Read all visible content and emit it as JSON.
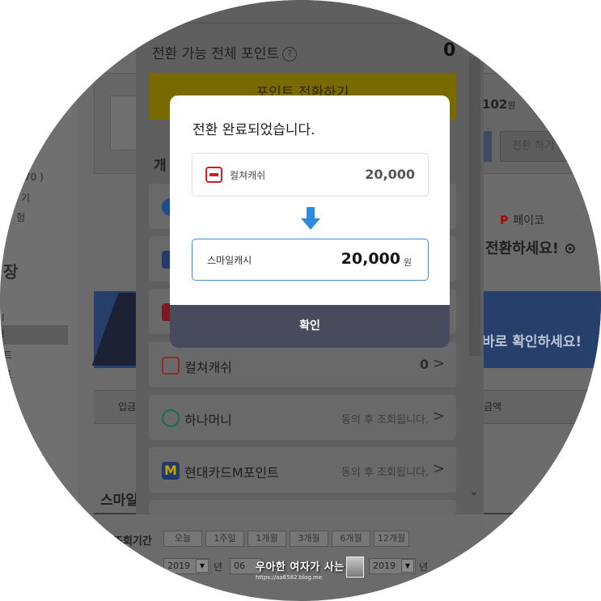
{
  "background": {
    "left_items": [
      "70 )",
      "기",
      "험",
      "장",
      "I",
      "l",
      "트",
      "트"
    ],
    "points_num": "102",
    "points_unit": "원",
    "right_btn": "전환 하기",
    "payco": "페이코",
    "convert_banner": "전환하세요!",
    "blue_banner": "바로 확인하세요!",
    "table_headers": [
      "입금",
      "금액"
    ],
    "bottom_title": "스마일",
    "period_label": "조회기간",
    "period_buttons": [
      "오늘",
      "1주일",
      "1개월",
      "3개월",
      "6개월",
      "12개월"
    ],
    "date_year_from": "2019",
    "date_month_from": "06",
    "date_year_to": "2019",
    "year_char": "년"
  },
  "panel": {
    "total_label": "전환 가능 전체 포인트",
    "help": "?",
    "total_value": "0",
    "convert_all_label": "포인트 전환하기",
    "list_header": "개",
    "items": [
      {
        "name": "컬쳐캐쉬",
        "value": "0"
      },
      {
        "name": "하나머니",
        "note": "동의 후 조회됩니다."
      },
      {
        "name": "현대카드M포인트",
        "note": "동의 후 조회됩니다."
      }
    ],
    "chevron": ">"
  },
  "modal": {
    "title": "전환 완료되었습니다.",
    "from_name": "컬쳐캐쉬",
    "from_value": "20,000",
    "to_name": "스마일캐시",
    "to_value": "20,000",
    "to_unit": "원",
    "confirm": "확인"
  },
  "watermark": {
    "title": "우아한 여자가 사는 법",
    "sub": "https://aa6582.blog.me"
  },
  "colors": {
    "accent_blue": "#3b8fd6",
    "confirm_bg": "#474b5b",
    "culture_red": "#d21e26"
  }
}
